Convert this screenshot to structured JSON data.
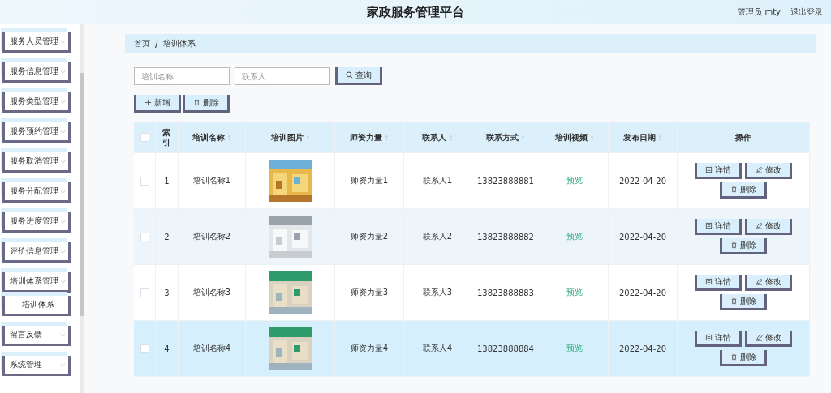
{
  "header": {
    "title": "家政服务管理平台",
    "user": "管理员 mty",
    "logout": "退出登录"
  },
  "sidebar": {
    "items": [
      {
        "label": "服务人员管理"
      },
      {
        "label": "服务信息管理"
      },
      {
        "label": "服务类型管理"
      },
      {
        "label": "服务预约管理"
      },
      {
        "label": "服务取消管理"
      },
      {
        "label": "服务分配管理"
      },
      {
        "label": "服务进度管理"
      },
      {
        "label": "评价信息管理"
      },
      {
        "label": "培训体系管理",
        "children": [
          {
            "label": "培训体系"
          }
        ]
      },
      {
        "label": "留言反馈"
      },
      {
        "label": "系统管理"
      }
    ]
  },
  "breadcrumb": [
    "首页",
    "培训体系"
  ],
  "breadcrumb_separator": "/",
  "search": {
    "fields": [
      {
        "placeholder": "培训名称"
      },
      {
        "placeholder": "联系人"
      }
    ],
    "button": "查询"
  },
  "actions": [
    {
      "kind": "add",
      "label": "新增"
    },
    {
      "kind": "delete",
      "label": "删除"
    }
  ],
  "table": {
    "select_all": {
      "checked": false
    },
    "columns": [
      {
        "label": "索引",
        "kind": "index"
      },
      {
        "label": "培训名称",
        "kind": "text"
      },
      {
        "label": "培训图片"
      },
      {
        "label": "师资力量",
        "kind": "text"
      },
      {
        "label": "联系人",
        "kind": "text"
      },
      {
        "label": "联系方式",
        "kind": "text"
      },
      {
        "label": "培训视频",
        "kind": "link"
      },
      {
        "label": "发布日期",
        "kind": "text"
      },
      {
        "label": "操作",
        "kind": "ops"
      }
    ],
    "rows": [
      {
        "checked": false,
        "highlighted": false,
        "cells": [
          "1",
          "培训名称1",
          {
            "kind": "picture"
          },
          "师资力量1",
          "联系人1",
          "13823888881",
          "预览",
          "2022-04-20",
          {
            "buttons": [
              {
                "kind": "detail",
                "label": "详情"
              },
              {
                "kind": "edit",
                "label": "修改"
              },
              {
                "kind": "delete",
                "label": "删除"
              }
            ]
          }
        ]
      },
      {
        "checked": false,
        "highlighted": false,
        "cells": [
          "2",
          "培训名称2",
          {
            "kind": "picture"
          },
          "师资力量2",
          "联系人2",
          "13823888882",
          "预览",
          "2022-04-20",
          {
            "buttons": [
              {
                "kind": "detail",
                "label": "详情"
              },
              {
                "kind": "edit",
                "label": "修改"
              },
              {
                "kind": "delete",
                "label": "删除"
              }
            ]
          }
        ]
      },
      {
        "checked": false,
        "highlighted": false,
        "cells": [
          "3",
          "培训名称3",
          {
            "kind": "picture"
          },
          "师资力量3",
          "联系人3",
          "13823888883",
          "预览",
          "2022-04-20",
          {
            "buttons": [
              {
                "kind": "detail",
                "label": "详情"
              },
              {
                "kind": "edit",
                "label": "修改"
              },
              {
                "kind": "delete",
                "label": "删除"
              }
            ]
          }
        ]
      },
      {
        "checked": false,
        "highlighted": true,
        "cells": [
          "4",
          "培训名称4",
          {
            "kind": "picture"
          },
          "师资力量4",
          "联系人4",
          "13823888884",
          "预览",
          "2022-04-20",
          {
            "buttons": [
              {
                "kind": "detail",
                "label": "详情"
              },
              {
                "kind": "edit",
                "label": "修改"
              },
              {
                "kind": "delete",
                "label": "删除"
              }
            ]
          }
        ]
      }
    ]
  }
}
